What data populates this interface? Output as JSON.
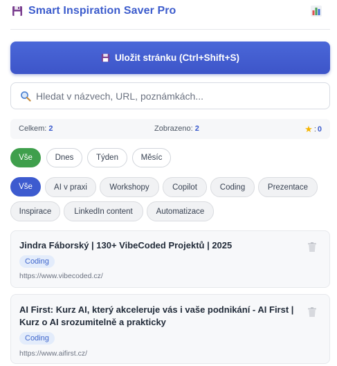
{
  "header": {
    "title": "Smart Inspiration Saver Pro"
  },
  "save_button": {
    "label": "Uložit stránku (Ctrl+Shift+S)"
  },
  "search": {
    "placeholder": "Hledat v názvech, URL, poznámkách...",
    "value": ""
  },
  "stats": {
    "total_label": "Celkem:",
    "total": "2",
    "shown_label": "Zobrazeno:",
    "shown": "2",
    "favorites_sep": ":",
    "favorites": "0"
  },
  "time_filters": [
    "Vše",
    "Dnes",
    "Týden",
    "Měsíc"
  ],
  "category_filters": [
    "Vše",
    "AI v praxi",
    "Workshopy",
    "Copilot",
    "Coding",
    "Prezentace",
    "Inspirace",
    "LinkedIn content",
    "Automatizace"
  ],
  "items": [
    {
      "title": "Jindra Fáborský | 130+ VibeCoded Projektů | 2025",
      "tag": "Coding",
      "url": "https://www.vibecoded.cz/"
    },
    {
      "title": "AI First: Kurz AI, který akceleruje vás i vaše podnikání - AI First | Kurz o AI srozumitelně a prakticky",
      "tag": "Coding",
      "url": "https://www.aifirst.cz/"
    }
  ],
  "colors": {
    "accent": "#3d5bcf",
    "active_filter": "#3f9f4c",
    "tag_bg": "#e3ecfb"
  },
  "icons": {
    "app": "floppy-disk-icon",
    "stats": "bar-chart-icon",
    "search": "search-icon",
    "favorites": "star-icon",
    "delete": "trash-icon"
  }
}
